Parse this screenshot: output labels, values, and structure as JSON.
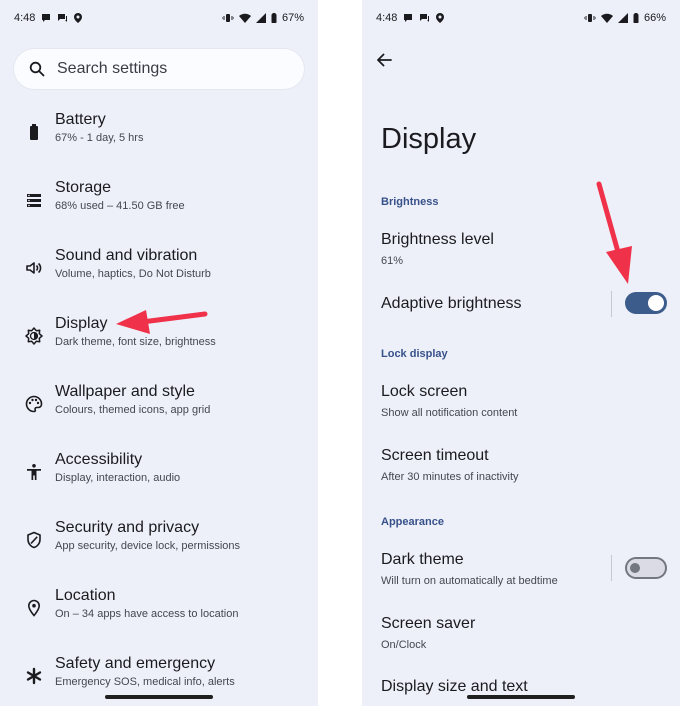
{
  "left_screen": {
    "status": {
      "time": "4:48",
      "battery": "67%"
    },
    "search": {
      "placeholder": "Search settings"
    },
    "items": [
      {
        "title": "Battery",
        "subtitle": "67% - 1 day, 5 hrs",
        "icon": "battery-icon"
      },
      {
        "title": "Storage",
        "subtitle": "68% used – 41.50 GB free",
        "icon": "storage-icon"
      },
      {
        "title": "Sound and vibration",
        "subtitle": "Volume, haptics, Do Not Disturb",
        "icon": "speaker-icon"
      },
      {
        "title": "Display",
        "subtitle": "Dark theme, font size, brightness",
        "icon": "brightness-icon"
      },
      {
        "title": "Wallpaper and style",
        "subtitle": "Colours, themed icons, app grid",
        "icon": "palette-icon"
      },
      {
        "title": "Accessibility",
        "subtitle": "Display, interaction, audio",
        "icon": "accessibility-icon"
      },
      {
        "title": "Security and privacy",
        "subtitle": "App security, device lock, permissions",
        "icon": "shield-icon"
      },
      {
        "title": "Location",
        "subtitle": "On – 34 apps have access to location",
        "icon": "location-pin-icon"
      },
      {
        "title": "Safety and emergency",
        "subtitle": "Emergency SOS, medical info, alerts",
        "icon": "asterisk-icon"
      }
    ]
  },
  "right_screen": {
    "status": {
      "time": "4:48",
      "battery": "66%"
    },
    "title": "Display",
    "sections": {
      "brightness": "Brightness",
      "lock_display": "Lock display",
      "appearance": "Appearance"
    },
    "items": {
      "brightness_level": {
        "title": "Brightness level",
        "subtitle": "61%"
      },
      "adaptive_brightness": {
        "title": "Adaptive brightness",
        "enabled": true
      },
      "lock_screen": {
        "title": "Lock screen",
        "subtitle": "Show all notification content"
      },
      "screen_timeout": {
        "title": "Screen timeout",
        "subtitle": "After 30 minutes of inactivity"
      },
      "dark_theme": {
        "title": "Dark theme",
        "subtitle": "Will turn on automatically at bedtime",
        "enabled": false
      },
      "screen_saver": {
        "title": "Screen saver",
        "subtitle": "On/Clock"
      },
      "display_size": {
        "title": "Display size and text"
      }
    }
  },
  "colors": {
    "background": "#eef0f9",
    "accent": "#3c5c8c",
    "section_header": "#37518a",
    "annotation_arrow": "#f0314a"
  }
}
